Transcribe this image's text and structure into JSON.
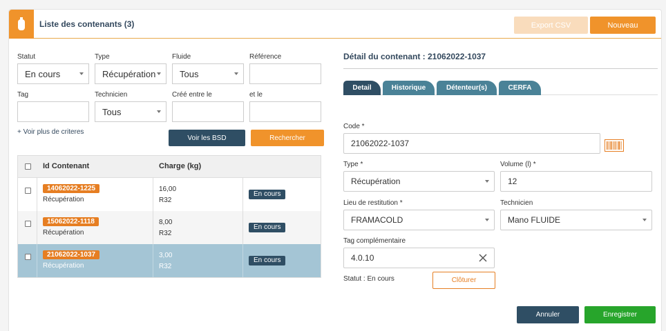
{
  "header": {
    "title": "Liste des contenants (3)",
    "export_label": "Export CSV",
    "new_label": "Nouveau",
    "icon": "gas-cylinder-icon"
  },
  "filters": {
    "statut": {
      "label": "Statut",
      "value": "En cours"
    },
    "type": {
      "label": "Type",
      "value": "Récupération"
    },
    "fluide": {
      "label": "Fluide",
      "value": "Tous"
    },
    "reference": {
      "label": "Référence",
      "value": ""
    },
    "tag": {
      "label": "Tag",
      "value": ""
    },
    "technicien": {
      "label": "Technicien",
      "value": "Tous"
    },
    "cree_entre": {
      "label": "Créé entre le",
      "value": ""
    },
    "et_le": {
      "label": "et le",
      "value": ""
    },
    "more_label": "+ Voir plus de criteres",
    "bsd_label": "Voir les BSD",
    "search_label": "Rechercher"
  },
  "table": {
    "columns": [
      "Id Contenant",
      "Charge (kg)"
    ],
    "rows": [
      {
        "id": "14062022-1225",
        "type": "Récupération",
        "charge": "16,00",
        "fluid": "R32",
        "status": "En cours",
        "selected": false
      },
      {
        "id": "15062022-1118",
        "type": "Récupération",
        "charge": "8,00",
        "fluid": "R32",
        "status": "En cours",
        "selected": false
      },
      {
        "id": "21062022-1037",
        "type": "Récupération",
        "charge": "3,00",
        "fluid": "R32",
        "status": "En cours",
        "selected": true
      }
    ]
  },
  "detail": {
    "title": "Détail du contenant : 21062022-1037",
    "tabs": [
      "Detail",
      "Historique",
      "Détenteur(s)",
      "CERFA"
    ],
    "active_tab": "Detail",
    "code_label": "Code *",
    "code_value": "21062022-1037",
    "barcode_icon": "barcode-icon",
    "type_label": "Type *",
    "type_value": "Récupération",
    "volume_label": "Volume (l) *",
    "volume_value": "12",
    "lieu_label": "Lieu de restitution *",
    "lieu_value": "FRAMACOLD",
    "technicien_label": "Technicien",
    "technicien_value": "Mano FLUIDE",
    "tag_label": "Tag complémentaire",
    "tag_value": "4.0.10",
    "statut_text": "Statut : En cours",
    "cloturer_label": "Clôturer",
    "cancel_label": "Annuler",
    "save_label": "Enregistrer"
  },
  "colors": {
    "accent": "#f0932b",
    "navy": "#2f4e64",
    "tab": "#4a8297",
    "selected_row": "#a4c5d5",
    "save": "#27a52b"
  }
}
